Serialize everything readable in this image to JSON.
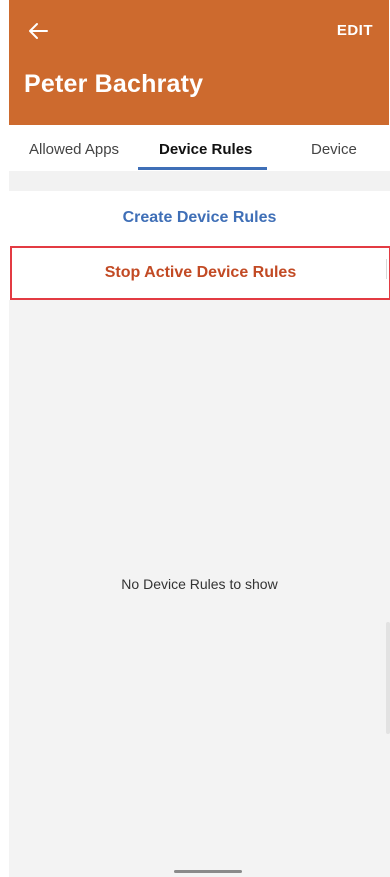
{
  "header": {
    "title": "Peter Bachraty",
    "edit_label": "EDIT",
    "back_icon": "arrow-left-icon",
    "background_color": "#cd6a2e"
  },
  "tabs": [
    {
      "label": "Allowed Apps"
    },
    {
      "label": "Device Rules",
      "active": true
    },
    {
      "label": "Device"
    }
  ],
  "actions": {
    "create_label": "Create Device Rules",
    "stop_label": "Stop Active Device Rules",
    "create_color": "#3f6fb7",
    "stop_color": "#c24a24",
    "highlight_border_color": "#e33b43"
  },
  "empty_state": {
    "message": "No Device Rules to show"
  }
}
